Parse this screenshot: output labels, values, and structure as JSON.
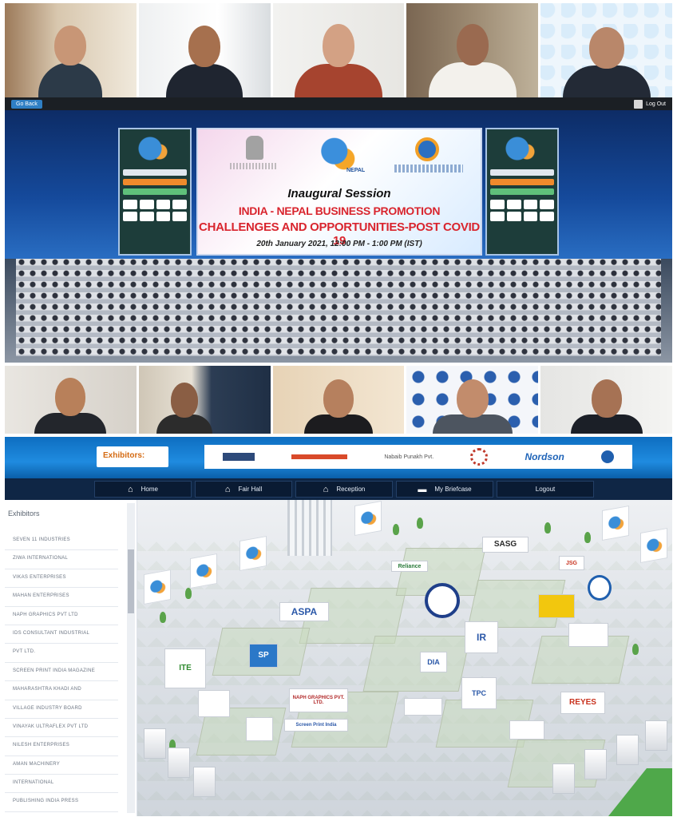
{
  "conference": {
    "go_back_label": "Go Back",
    "log_out_label": "Log Out"
  },
  "session_screen": {
    "brand_text": "NEPAL",
    "title": "Inaugural Session",
    "line1": "INDIA - NEPAL BUSINESS PROMOTION",
    "line2": "CHALLENGES AND OPPORTUNITIES-POST COVID 19",
    "date": "20th January 2021, 12:00 PM - 1:00 PM (IST)"
  },
  "exhibit_banner": {
    "label": "Exhibitors:",
    "sponsors": [
      "Nabaib Punakh Pvt.",
      "Nordson"
    ]
  },
  "nav": {
    "items": [
      {
        "label": "Home",
        "icon": "home-icon"
      },
      {
        "label": "Fair Hall",
        "icon": "home-icon"
      },
      {
        "label": "Reception",
        "icon": "home-icon"
      },
      {
        "label": "My Briefcase",
        "icon": "briefcase-icon"
      },
      {
        "label": "Logout",
        "icon": ""
      }
    ]
  },
  "sidebar": {
    "title": "Exhibitors",
    "items": [
      "SEVEN 11 INDUSTRIES",
      "ZIWA INTERNATIONAL",
      "VIKAS ENTERPRISES",
      "MAHAN ENTERPRISES",
      "NAPH GRAPHICS PVT LTD",
      "IDS CONSULTANT INDUSTRIAL",
      "PVT LTD.",
      "SCREEN PRINT INDIA MAGAZINE",
      "MAHARASHTRA KHADI AND",
      "VILLAGE INDUSTRY BOARD",
      "VINAYAK ULTRAFLEX PVT LTD",
      "NILESH ENTERPRISES",
      "AMAN MACHINERY",
      "INTERNATIONAL",
      "PUBLISHING INDIA PRESS"
    ]
  },
  "hall": {
    "booth_logos": [
      "ASPA",
      "SASG",
      "Reliance",
      "DIA",
      "NAPH GRAPHICS PVT. LTD.",
      "Screen Print India",
      "ITE",
      "REYES",
      "IR",
      "TPC",
      "SP",
      "JSG"
    ],
    "colors": {
      "nav_bg": "#0f2645",
      "banner_blue": "#1f8be0",
      "accent_orange": "#d46a12",
      "title_red": "#d9252e"
    }
  }
}
